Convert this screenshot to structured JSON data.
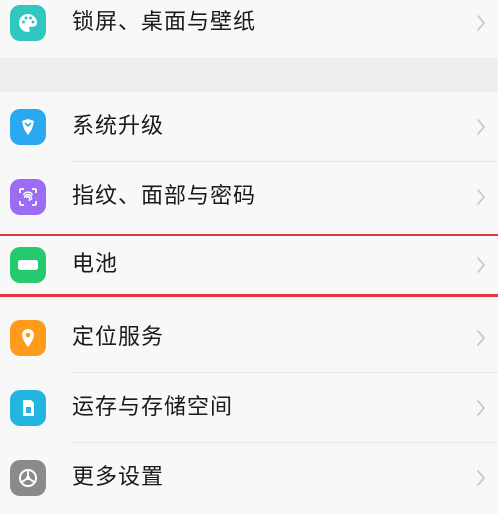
{
  "settings": {
    "items": [
      {
        "label": "锁屏、桌面与壁纸",
        "icon": "palette-icon"
      },
      {
        "label": "系统升级",
        "icon": "update-icon"
      },
      {
        "label": "指纹、面部与密码",
        "icon": "fingerprint-icon"
      },
      {
        "label": "电池",
        "icon": "battery-icon"
      },
      {
        "label": "定位服务",
        "icon": "location-pin-icon"
      },
      {
        "label": "运存与存储空间",
        "icon": "storage-icon"
      },
      {
        "label": "更多设置",
        "icon": "more-settings-icon"
      }
    ]
  },
  "colors": {
    "palette_icon": "#2fc7c0",
    "update_icon": "#2aa9f0",
    "fingerprint_icon": "#9b6cf4",
    "battery_icon": "#25c96e",
    "location_icon": "#ff9b1a",
    "storage_icon": "#21b5e0",
    "more_settings_icon": "#8a8a8a",
    "highlight_border": "#e0383e"
  }
}
